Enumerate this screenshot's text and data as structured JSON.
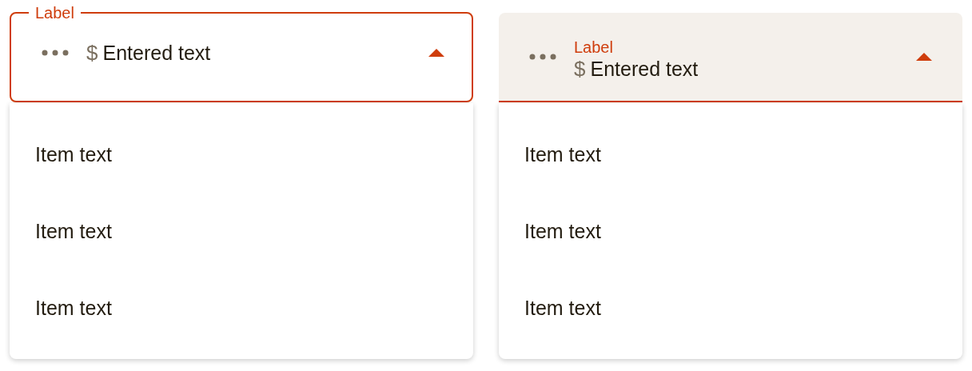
{
  "selects": [
    {
      "kind": "outlined",
      "label": "Label",
      "prefix": "$",
      "value": "Entered text",
      "expanded": true,
      "items": [
        {
          "label": "Item text"
        },
        {
          "label": "Item text"
        },
        {
          "label": "Item text"
        }
      ]
    },
    {
      "kind": "filled",
      "label": "Label",
      "prefix": "$",
      "value": "Entered text",
      "expanded": true,
      "items": [
        {
          "label": "Item text"
        },
        {
          "label": "Item text"
        },
        {
          "label": "Item text"
        }
      ]
    }
  ]
}
